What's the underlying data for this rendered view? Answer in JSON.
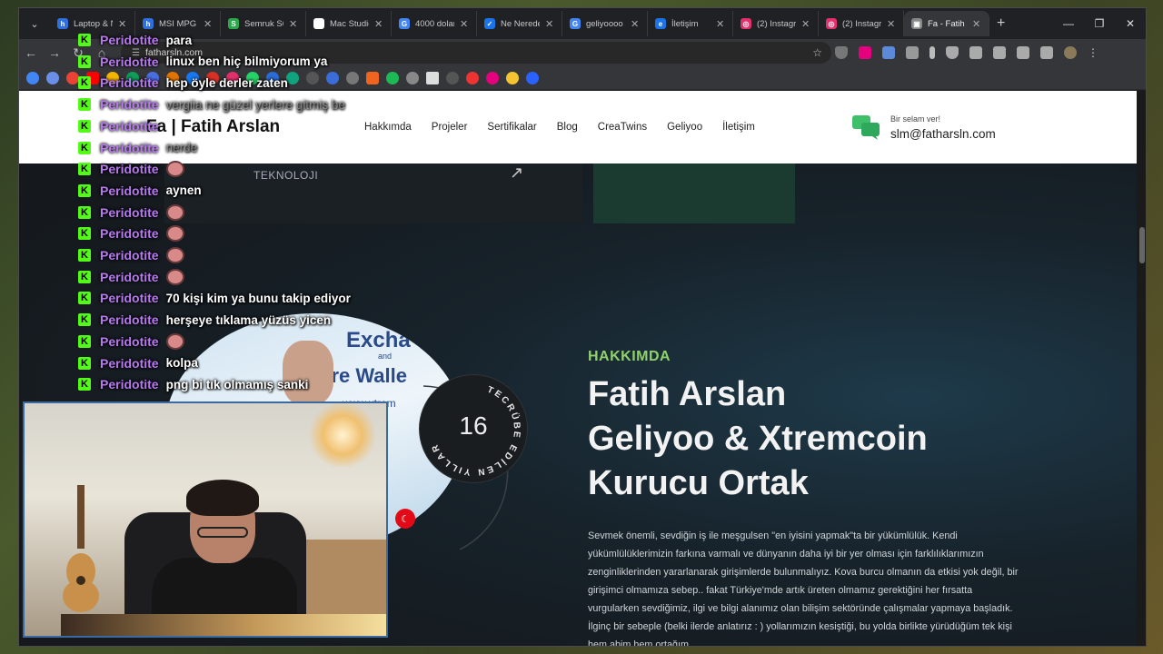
{
  "browser": {
    "tabs": [
      {
        "title": "Laptop & N",
        "favicon_color": "#2f6fe0",
        "glyph": "h"
      },
      {
        "title": "MSI MPG S",
        "favicon_color": "#2f6fe0",
        "glyph": "h"
      },
      {
        "title": "Semruk S6",
        "favicon_color": "#2aa84a",
        "glyph": "S"
      },
      {
        "title": "Mac Studio",
        "favicon_color": "#ffffff",
        "glyph": ""
      },
      {
        "title": "4000 dolar",
        "favicon_color": "#4285f4",
        "glyph": "G"
      },
      {
        "title": "Ne Nerede",
        "favicon_color": "#1a73e8",
        "glyph": "✓"
      },
      {
        "title": "geliyoooo",
        "favicon_color": "#4285f4",
        "glyph": "G"
      },
      {
        "title": "İletişim",
        "favicon_color": "#1a73e8",
        "glyph": "e"
      },
      {
        "title": "(2) Instagra",
        "favicon_color": "#e1306c",
        "glyph": "◎"
      },
      {
        "title": "(2) Instagra",
        "favicon_color": "#e1306c",
        "glyph": "◎"
      },
      {
        "title": "Fa - Fatih A",
        "favicon_color": "#888888",
        "glyph": "▣"
      }
    ],
    "active_tab_index": 10,
    "url": "fatharsln.com"
  },
  "site": {
    "logo": "Fa | Fatih Arslan",
    "nav": [
      "Hakkımda",
      "Projeler",
      "Sertifikalar",
      "Blog",
      "CreaTwins",
      "Geliyoo",
      "İletişim"
    ],
    "contact_small": "Bir selam ver!",
    "contact_email": "slm@fatharsln.com",
    "card_label": "TEKNOLOJI",
    "badge_number": "16",
    "badge_text": "TECRÜBE EDİLEN YILLAR",
    "about_label": "HAKKIMDA",
    "about_title_lines": [
      "Fatih Arslan",
      "Geliyoo & Xtremcoin",
      "Kurucu Ortak"
    ],
    "about_body": "Sevmek önemli, sevdiğin iş ile meşgulsen \"en iyisini yapmak\"ta bir yükümlülük. Kendi yükümlülüklerimizin farkına varmalı ve dünyanın daha iyi bir yer olması için farklılıklarımızın zenginliklerinden yararlanarak girişimlerde bulunmalıyız. Kova burcu olmanın da etkisi yok değil, bir girişimci olmamıza sebep.. fakat Türkiye'mde artık üreten olmamız gerektiğini her fırsatta vurgularken sevdiğimiz, ilgi ve bilgi alanımız olan bilişim sektöründe çalışmalar yapmaya başladık. İlginç bir sebeple (belki ilerde anlatırız : ) yollarımızın kesiştiği, bu yolda birlikte yürüdüğüm tek kişi hem abim hem ortağım",
    "hero_texts": [
      "Excha",
      "ure Walle",
      "www.xtrem"
    ],
    "hero_small": "and"
  },
  "chat": [
    {
      "user": "Peridotite",
      "msg": "para"
    },
    {
      "user": "Peridotite",
      "msg": "linux ben hiç bilmiyorum ya"
    },
    {
      "user": "Peridotite",
      "msg": "hep öyle derler zaten"
    },
    {
      "user": "Peridotite",
      "msg": "vergiia ne güzel yerlere gitmiş be"
    },
    {
      "user": "Peridotite",
      "msg": ""
    },
    {
      "user": "Peridotite",
      "msg": "nerde"
    },
    {
      "user": "Peridotite",
      "msg": "",
      "emote": true
    },
    {
      "user": "Peridotite",
      "msg": "aynen"
    },
    {
      "user": "Peridotite",
      "msg": "",
      "emote": true
    },
    {
      "user": "Peridotite",
      "msg": "",
      "emote": true
    },
    {
      "user": "Peridotite",
      "msg": "",
      "emote": true
    },
    {
      "user": "Peridotite",
      "msg": "",
      "emote": true
    },
    {
      "user": "Peridotite",
      "msg": "70 kişi kim ya bunu takip ediyor"
    },
    {
      "user": "Peridotite",
      "msg": "herşeye tıklama yüzüs yicen"
    },
    {
      "user": "Peridotite",
      "msg": "",
      "emote": true
    },
    {
      "user": "Peridotite",
      "msg": "kolpa"
    },
    {
      "user": "Peridotite",
      "msg": "png bi tık olmamış sanki"
    }
  ],
  "colors": {
    "kick_green": "#53fc18",
    "username": "#b779f0",
    "accent_green": "#8fd16a"
  }
}
